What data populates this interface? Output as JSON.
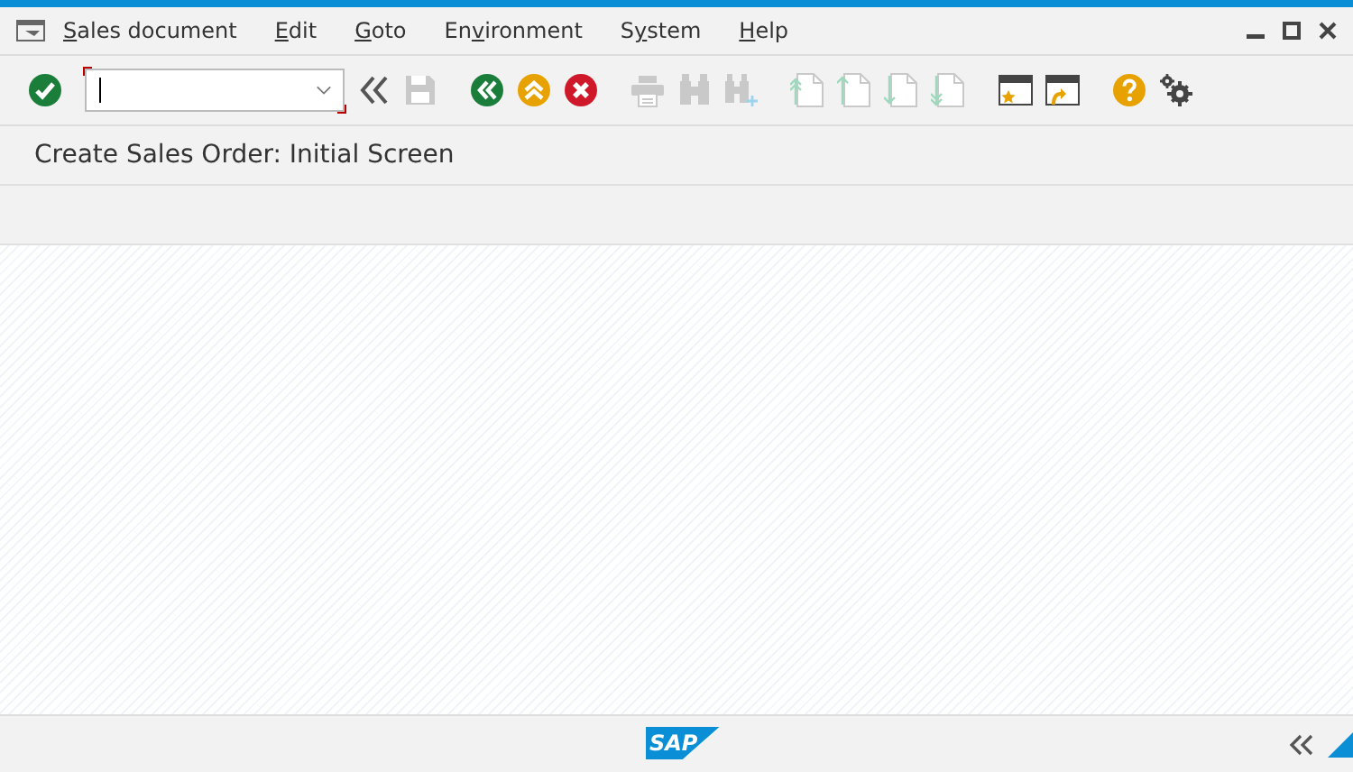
{
  "menu_bar": {
    "items": [
      {
        "parts": [
          {
            "text": "S",
            "underlined": true
          },
          {
            "text": "ales document",
            "underlined": false
          }
        ]
      },
      {
        "parts": [
          {
            "text": "E",
            "underlined": true
          },
          {
            "text": "dit",
            "underlined": false
          }
        ]
      },
      {
        "parts": [
          {
            "text": "G",
            "underlined": true
          },
          {
            "text": "oto",
            "underlined": false
          }
        ]
      },
      {
        "parts": [
          {
            "text": "En",
            "underlined": false
          },
          {
            "text": "v",
            "underlined": true
          },
          {
            "text": "ironment",
            "underlined": false
          }
        ]
      },
      {
        "parts": [
          {
            "text": "S",
            "underlined": false
          },
          {
            "text": "y",
            "underlined": true
          },
          {
            "text": "stem",
            "underlined": false
          }
        ]
      },
      {
        "parts": [
          {
            "text": "H",
            "underlined": true
          },
          {
            "text": "elp",
            "underlined": false
          }
        ]
      }
    ]
  },
  "toolbar": {
    "groups": [
      [
        {
          "kind": "enter",
          "disabled": false
        },
        {
          "kind": "command_field"
        }
      ],
      [
        {
          "kind": "collapse",
          "disabled": false
        },
        {
          "kind": "save",
          "disabled": true
        }
      ],
      [
        {
          "kind": "back",
          "disabled": false
        },
        {
          "kind": "exit",
          "disabled": false
        },
        {
          "kind": "cancel",
          "disabled": false
        }
      ],
      [
        {
          "kind": "print",
          "disabled": true
        },
        {
          "kind": "find",
          "disabled": true
        },
        {
          "kind": "find_next",
          "disabled": true
        }
      ],
      [
        {
          "kind": "first_page",
          "disabled": true
        },
        {
          "kind": "previous_page",
          "disabled": true
        },
        {
          "kind": "next_page",
          "disabled": true
        },
        {
          "kind": "last_page",
          "disabled": true
        }
      ],
      [
        {
          "kind": "new_session",
          "disabled": false
        },
        {
          "kind": "shortcut",
          "disabled": false
        }
      ],
      [
        {
          "kind": "help",
          "disabled": false
        },
        {
          "kind": "customize",
          "disabled": false
        }
      ]
    ]
  },
  "screen": {
    "title": "Create Sales Order: Initial Screen"
  },
  "footer": {
    "logo": "SAP"
  }
}
